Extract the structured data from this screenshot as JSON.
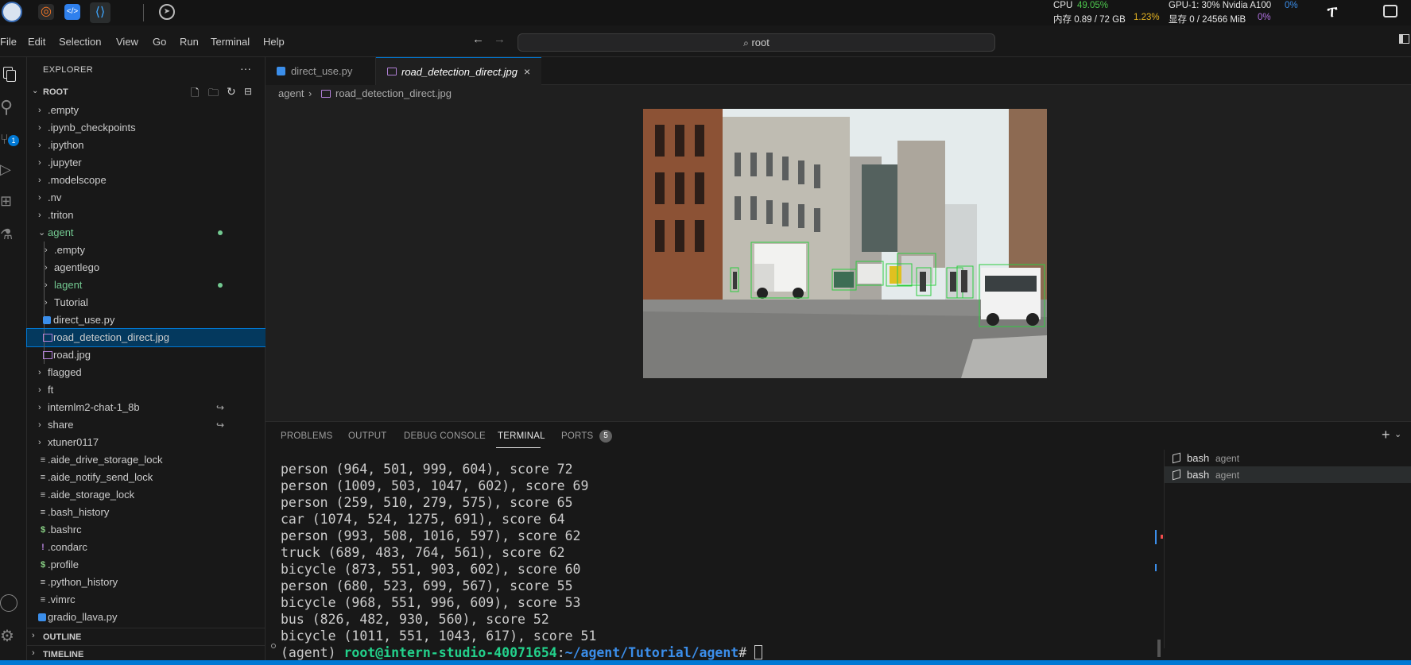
{
  "topbar": {
    "cpu_label": "CPU",
    "cpu_value": "49.05%",
    "mem_label": "内存 0.89 / 72 GB",
    "mem_value": "1.23%",
    "gpu_label": "GPU-1: 30% Nvidia A100",
    "gpu_value": "0%",
    "vram_label": "显存 0 / 24566 MiB",
    "vram_value": "0%"
  },
  "menu": [
    "File",
    "Edit",
    "Selection",
    "View",
    "Go",
    "Run",
    "Terminal",
    "Help"
  ],
  "search": {
    "value": "root"
  },
  "activity": {
    "scm_badge": "1"
  },
  "explorer": {
    "title": "EXPLORER",
    "more": "···",
    "root_label": "ROOT",
    "items": [
      {
        "label": ".empty",
        "type": "folder"
      },
      {
        "label": ".ipynb_checkpoints",
        "type": "folder"
      },
      {
        "label": ".ipython",
        "type": "folder"
      },
      {
        "label": ".jupyter",
        "type": "folder"
      },
      {
        "label": ".modelscope",
        "type": "folder"
      },
      {
        "label": ".nv",
        "type": "folder"
      },
      {
        "label": ".triton",
        "type": "folder"
      },
      {
        "label": "agent",
        "type": "folder-open"
      },
      {
        "label": ".empty",
        "type": "subfolder"
      },
      {
        "label": "agentlego",
        "type": "subfolder"
      },
      {
        "label": "lagent",
        "type": "subfolder"
      },
      {
        "label": "Tutorial",
        "type": "subfolder"
      },
      {
        "label": "direct_use.py",
        "type": "py"
      },
      {
        "label": "road_detection_direct.jpg",
        "type": "img"
      },
      {
        "label": "road.jpg",
        "type": "img"
      },
      {
        "label": "flagged",
        "type": "folder"
      },
      {
        "label": "ft",
        "type": "folder"
      },
      {
        "label": "internlm2-chat-1_8b",
        "type": "folder"
      },
      {
        "label": "share",
        "type": "folder"
      },
      {
        "label": "xtuner0117",
        "type": "folder"
      },
      {
        "label": ".aide_drive_storage_lock",
        "type": "file"
      },
      {
        "label": ".aide_notify_send_lock",
        "type": "file"
      },
      {
        "label": ".aide_storage_lock",
        "type": "file"
      },
      {
        "label": ".bash_history",
        "type": "file"
      },
      {
        "label": ".bashrc",
        "type": "dollar"
      },
      {
        "label": ".condarc",
        "type": "bang"
      },
      {
        "label": ".profile",
        "type": "dollar"
      },
      {
        "label": ".python_history",
        "type": "file"
      },
      {
        "label": ".vimrc",
        "type": "file"
      },
      {
        "label": "gradio_llava.py",
        "type": "py"
      }
    ],
    "outline": "OUTLINE",
    "timeline": "TIMELINE"
  },
  "tabs": [
    {
      "label": "direct_use.py"
    },
    {
      "label": "road_detection_direct.jpg"
    }
  ],
  "breadcrumb": {
    "folder": "agent",
    "file": "road_detection_direct.jpg"
  },
  "panel": {
    "tabs": [
      "PROBLEMS",
      "OUTPUT",
      "DEBUG CONSOLE",
      "TERMINAL",
      "PORTS"
    ],
    "ports_count": "5",
    "terminals": [
      {
        "name": "bash",
        "cwd": "agent"
      },
      {
        "name": "bash",
        "cwd": "agent"
      }
    ]
  },
  "terminal": {
    "lines": [
      "person (964, 501, 999, 604), score 72",
      "person (1009, 503, 1047, 602), score 69",
      "person (259, 510, 279, 575), score 65",
      "car (1074, 524, 1275, 691), score 64",
      "person (993, 508, 1016, 597), score 62",
      "truck (689, 483, 764, 561), score 62",
      "bicycle (873, 551, 903, 602), score 60",
      "person (680, 523, 699, 567), score 55",
      "bicycle (968, 551, 996, 609), score 53",
      "bus (826, 482, 930, 560), score 52",
      "bicycle (1011, 551, 1043, 617), score 51"
    ],
    "prompt_env": "(agent) ",
    "prompt_user": "root@intern-studio-40071654",
    "prompt_sep": ":",
    "prompt_path": "~/agent/Tutorial/agent",
    "prompt_end": "# "
  }
}
